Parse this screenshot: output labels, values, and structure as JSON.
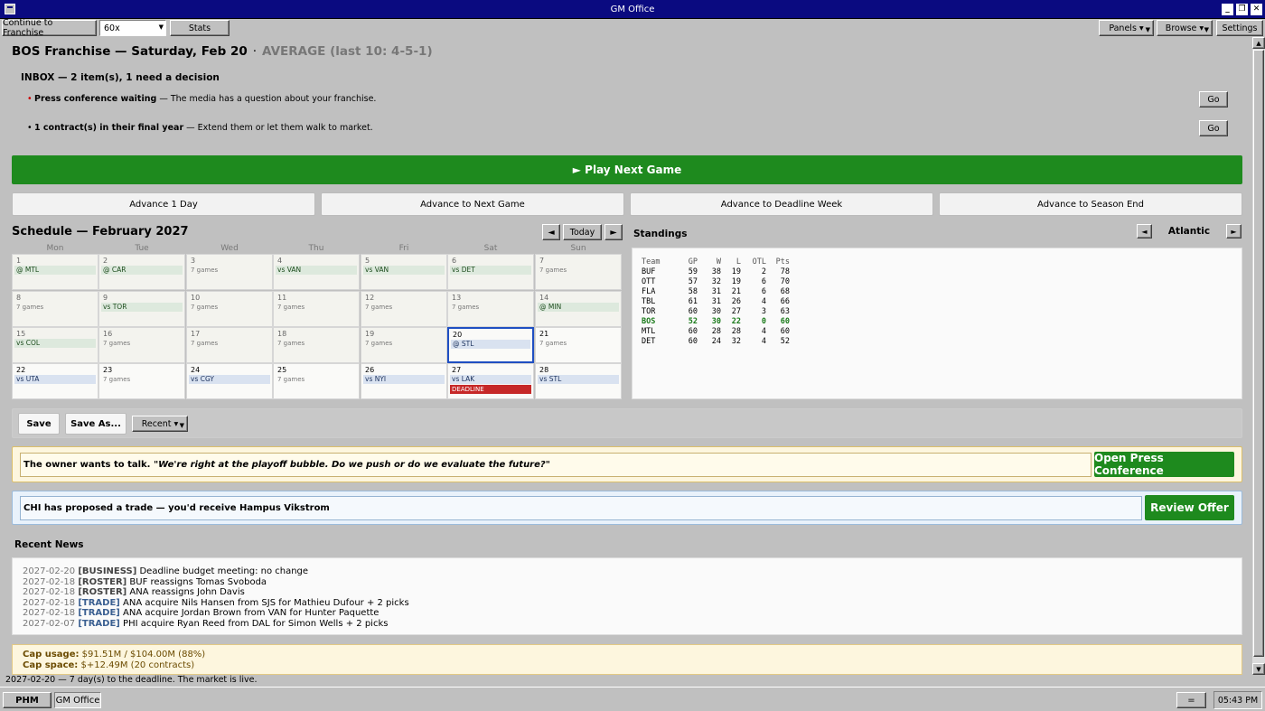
{
  "window": {
    "title": "GM Office"
  },
  "toolbar": {
    "continue": "Continue to Franchise",
    "zoom": "60x",
    "stats": "Stats",
    "panels": "Panels ▾",
    "browse": "Browse ▾",
    "settings": "Settings"
  },
  "header": {
    "title": "BOS Franchise — Saturday, Feb 20",
    "separator": "·",
    "form": "AVERAGE (last 10: 4-5-1)"
  },
  "inbox": {
    "title": "INBOX — 2 item(s), 1 need a decision",
    "items": [
      {
        "bullet": "•",
        "bold": "Press conference waiting",
        "text": " — The media has a question about your franchise.",
        "go": "Go"
      },
      {
        "bullet": "•",
        "bold": "1 contract(s) in their final year",
        "text": " — Extend them or let them walk to market.",
        "go": "Go"
      }
    ]
  },
  "play": {
    "label": "► Play Next Game"
  },
  "advance": [
    "Advance 1 Day",
    "Advance to Next Game",
    "Advance to Deadline Week",
    "Advance to Season End"
  ],
  "schedule": {
    "title": "Schedule — February 2027",
    "prev": "◄",
    "today": "Today",
    "next": "►",
    "dow": [
      "Mon",
      "Tue",
      "Wed",
      "Thu",
      "Fri",
      "Sat",
      "Sun"
    ],
    "days": [
      {
        "d": "1",
        "ev": "@ MTL",
        "t": "away"
      },
      {
        "d": "2",
        "ev": "@ CAR",
        "t": "away"
      },
      {
        "d": "3",
        "g": "7 games"
      },
      {
        "d": "4",
        "ev": "vs VAN",
        "t": "away"
      },
      {
        "d": "5",
        "ev": "vs VAN",
        "t": "away"
      },
      {
        "d": "6",
        "ev": "vs DET",
        "t": "away"
      },
      {
        "d": "7",
        "g": "7 games"
      },
      {
        "d": "8",
        "g": "7 games"
      },
      {
        "d": "9",
        "ev": "vs TOR",
        "t": "away"
      },
      {
        "d": "10",
        "g": "7 games"
      },
      {
        "d": "11",
        "g": "7 games"
      },
      {
        "d": "12",
        "g": "7 games"
      },
      {
        "d": "13",
        "g": "7 games"
      },
      {
        "d": "14",
        "ev": "@ MIN",
        "t": "away"
      },
      {
        "d": "15",
        "ev": "vs COL",
        "t": "away"
      },
      {
        "d": "16",
        "g": "7 games"
      },
      {
        "d": "17",
        "g": "7 games"
      },
      {
        "d": "18",
        "g": "7 games"
      },
      {
        "d": "19",
        "g": "7 games"
      },
      {
        "d": "20",
        "ev": "@ STL",
        "t": "home",
        "today": true
      },
      {
        "d": "21",
        "g": "7 games"
      },
      {
        "d": "22",
        "ev": "vs UTA",
        "t": "home"
      },
      {
        "d": "23",
        "g": "7 games"
      },
      {
        "d": "24",
        "ev": "vs CGY",
        "t": "home"
      },
      {
        "d": "25",
        "g": "7 games"
      },
      {
        "d": "26",
        "ev": "vs NYI",
        "t": "home"
      },
      {
        "d": "27",
        "ev": "vs LAK",
        "t": "home",
        "deadline": "DEADLINE"
      },
      {
        "d": "28",
        "ev": "vs STL",
        "t": "home"
      }
    ]
  },
  "standings": {
    "title": "Standings",
    "prev": "◄",
    "next": "►",
    "division": "Atlantic",
    "columns": [
      "Team",
      "GP",
      "W",
      "L",
      "OTL",
      "Pts"
    ],
    "rows": [
      [
        "BUF",
        "59",
        "38",
        "19",
        "2",
        "78"
      ],
      [
        "OTT",
        "57",
        "32",
        "19",
        "6",
        "70"
      ],
      [
        "FLA",
        "58",
        "31",
        "21",
        "6",
        "68"
      ],
      [
        "TBL",
        "61",
        "31",
        "26",
        "4",
        "66"
      ],
      [
        "TOR",
        "60",
        "30",
        "27",
        "3",
        "63"
      ],
      [
        "BOS",
        "52",
        "30",
        "22",
        "0",
        "60"
      ],
      [
        "MTL",
        "60",
        "28",
        "28",
        "4",
        "60"
      ],
      [
        "DET",
        "60",
        "24",
        "32",
        "4",
        "52"
      ]
    ],
    "highlight": "BOS"
  },
  "saves": {
    "save": "Save",
    "save_as": "Save As...",
    "recent": "Recent ▾"
  },
  "owner": {
    "lead": "The owner wants to talk. ",
    "quote": "\"We're right at the playoff bubble. Do we push or do we evaluate the future?\"",
    "button": "Open Press Conference"
  },
  "trade": {
    "message": "CHI has proposed a trade — you'd receive Hampus Vikstrom",
    "button": "Review Offer"
  },
  "news": {
    "title": "Recent News",
    "items": [
      {
        "date": "2027-02-20",
        "tag": "[BUSINESS]",
        "kind": "other",
        "text": " Deadline budget meeting: no change"
      },
      {
        "date": "2027-02-18",
        "tag": "[ROSTER]",
        "kind": "other",
        "text": " BUF reassigns Tomas Svoboda"
      },
      {
        "date": "2027-02-18",
        "tag": "[ROSTER]",
        "kind": "other",
        "text": " ANA reassigns John Davis"
      },
      {
        "date": "2027-02-18",
        "tag": "[TRADE]",
        "kind": "trade",
        "text": " ANA acquire Nils Hansen from SJS for Mathieu Dufour + 2 picks"
      },
      {
        "date": "2027-02-18",
        "tag": "[TRADE]",
        "kind": "trade",
        "text": " ANA acquire Jordan Brown from VAN for Hunter Paquette"
      },
      {
        "date": "2027-02-07",
        "tag": "[TRADE]",
        "kind": "trade",
        "text": " PHI acquire Ryan Reed from DAL for Simon Wells + 2 picks"
      }
    ]
  },
  "cap": {
    "usage_label": "Cap usage:",
    "usage_value": " $91.51M / $104.00M (88%)",
    "space_label": "Cap space:",
    "space_value": " $+12.49M",
    "space_note": " (20 contracts)"
  },
  "status": "2027-02-20 — 7 day(s) to the deadline. The market is live.",
  "taskbar": {
    "start": "PHM",
    "task": "GM Office",
    "tray": "=",
    "clock": "05:43 PM"
  }
}
